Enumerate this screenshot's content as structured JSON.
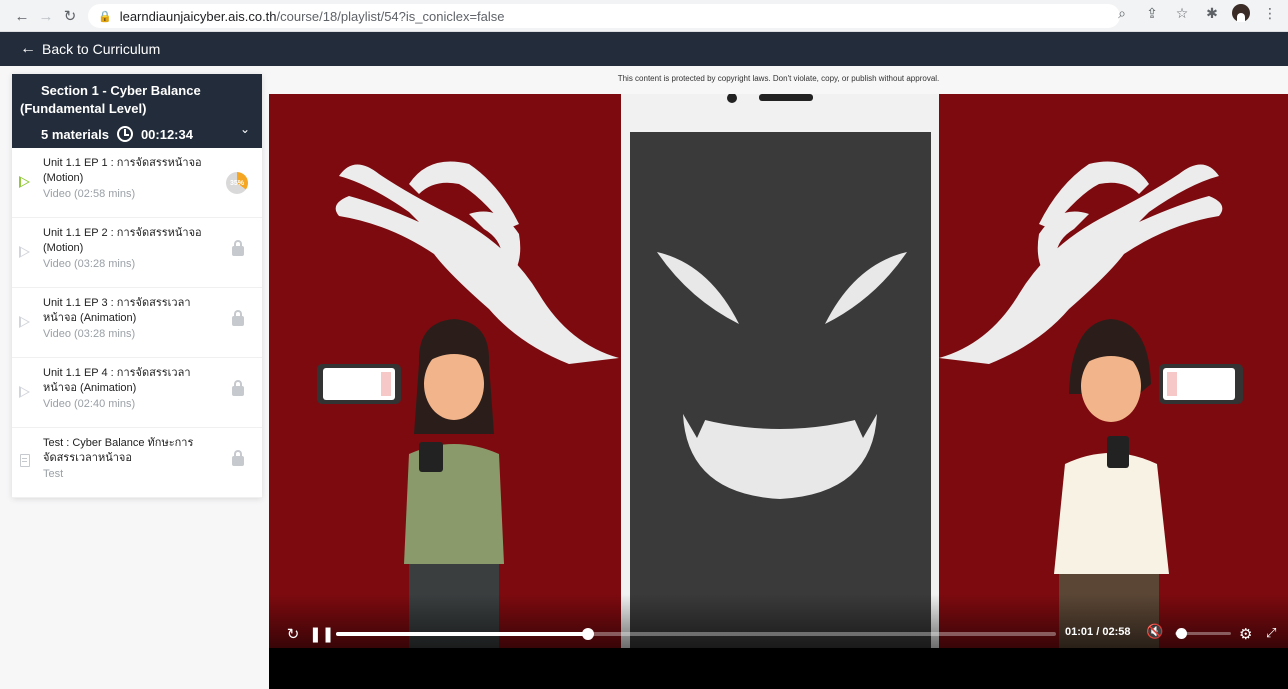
{
  "browser": {
    "url_domain": "learndiaunjaicyber.ais.co.th",
    "url_path": "/course/18/playlist/54?is_coniclex=false"
  },
  "topnav": {
    "back_label": "Back to Curriculum"
  },
  "section": {
    "title_line1": "Section 1 - Cyber Balance",
    "title_line2": "(Fundamental Level)",
    "materials": "5 materials",
    "duration": "00:12:34"
  },
  "items": [
    {
      "title_line1": "Unit 1.1 EP 1 : การจัดสรรหน้าจอ",
      "title_line2": "(Motion)",
      "meta": "Video  (02:58 mins)",
      "progress_label": "35%",
      "progress": 35,
      "status": "in-progress"
    },
    {
      "title_line1": "Unit 1.1 EP 2 : การจัดสรรหน้าจอ",
      "title_line2": "(Motion)",
      "meta": "Video  (03:28 mins)",
      "status": "locked"
    },
    {
      "title_line1": "Unit 1.1 EP 3 : การจัดสรรเวลา",
      "title_line2": "หน้าจอ (Animation)",
      "meta": "Video  (03:28 mins)",
      "status": "locked"
    },
    {
      "title_line1": "Unit 1.1 EP 4 : การจัดสรรเวลา",
      "title_line2": "หน้าจอ (Animation)",
      "meta": "Video  (02:40 mins)",
      "status": "locked"
    },
    {
      "title_line1": "Test : Cyber Balance ทักษะการ",
      "title_line2": "จัดสรรเวลาหน้าจอ",
      "meta": "Test",
      "status": "locked"
    }
  ],
  "player": {
    "copyright_notice": "This content is protected by copyright laws. Don't violate, copy, or publish without approval.",
    "current_time": "01:01",
    "total_time": "02:58",
    "progress": 0.35,
    "volume": 0.1
  },
  "colors": {
    "navy": "#222c3a",
    "video_red": "#7d0a0f",
    "active_green": "#94c83d",
    "progress_orange": "#f5a623"
  }
}
